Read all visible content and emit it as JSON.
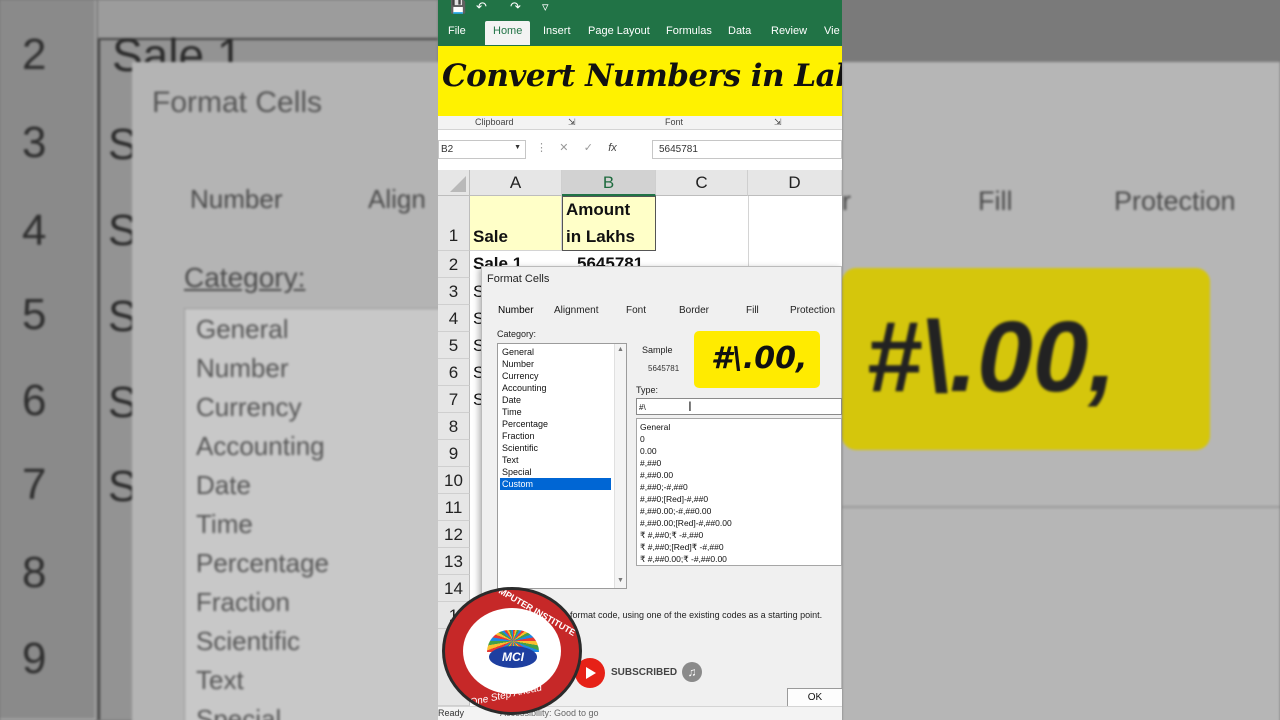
{
  "banner": {
    "title": "Convert Numbers in Lakhs"
  },
  "ribbon": {
    "tabs": [
      "File",
      "Home",
      "Insert",
      "Page Layout",
      "Formulas",
      "Data",
      "Review",
      "Vie"
    ],
    "groups": [
      "Clipboard",
      "Font"
    ]
  },
  "formula_bar": {
    "name_box": "B2",
    "fx": "fx",
    "value": "5645781"
  },
  "sheet": {
    "columns": [
      "A",
      "B",
      "C",
      "D"
    ],
    "rows": [
      "1",
      "2",
      "3",
      "4",
      "5",
      "6",
      "7",
      "8",
      "9",
      "10",
      "11",
      "12",
      "13",
      "14",
      "1"
    ],
    "A1": "Sale",
    "B1_line1": "Amount",
    "B1_line2": "in Lakhs",
    "A2": "Sale 1",
    "B2": "5645781",
    "stub": "S"
  },
  "dialog": {
    "title": "Format Cells",
    "tabs": [
      "Number",
      "Alignment",
      "Font",
      "Border",
      "Fill",
      "Protection"
    ],
    "category_label": "Category:",
    "categories": [
      "General",
      "Number",
      "Currency",
      "Accounting",
      "Date",
      "Time",
      "Percentage",
      "Fraction",
      "Scientific",
      "Text",
      "Special",
      "Custom"
    ],
    "selected_category": "Custom",
    "sample_label": "Sample",
    "sample_value": "5645781",
    "callout": "#\\.00,",
    "type_label": "Type:",
    "type_value": "#\\",
    "formats": [
      "General",
      "0",
      "0.00",
      "#,##0",
      "#,##0.00",
      "#,##0;-#,##0",
      "#,##0;[Red]-#,##0",
      "#,##0.00;-#,##0.00",
      "#,##0.00;[Red]-#,##0.00",
      "₹ #,##0;₹ -#,##0",
      "₹ #,##0;[Red]₹ -#,##0",
      "₹ #,##0.00;₹ -#,##0.00"
    ],
    "hint": "format code, using one of the existing codes as a starting point.",
    "ok": "OK"
  },
  "overlay": {
    "subscribed": "SUBSCRIBED"
  },
  "logo": {
    "ring_text": "MINI COMPUTER INSTITUTE",
    "mark": "MCI",
    "tagline": "One Step Ahead"
  },
  "status": {
    "ready": "Ready",
    "accessibility": "Accessibility: Good to go"
  },
  "bg_left": {
    "rows": [
      "2",
      "3",
      "4",
      "5",
      "6",
      "7",
      "8",
      "9"
    ],
    "sale": "Sale 1",
    "title": "Format Cells",
    "tab1": "Number",
    "tab2": "Align",
    "category": "Category:",
    "items": [
      "General",
      "Number",
      "Currency",
      "Accounting",
      "Date",
      "Time",
      "Percentage",
      "Fraction",
      "Scientific",
      "Text",
      "Special"
    ]
  },
  "bg_right": {
    "tab1": "r",
    "tab2": "Fill",
    "tab3": "Protection",
    "callout": "#\\.00,"
  }
}
